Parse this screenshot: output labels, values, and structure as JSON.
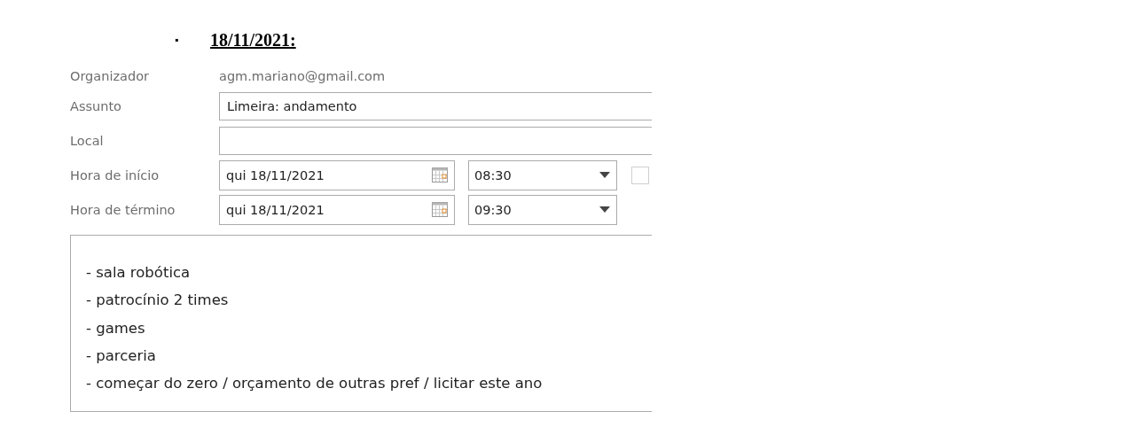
{
  "heading": {
    "bullet": "▪",
    "date": "18/11/2021:"
  },
  "organizer": {
    "label": "Organizador",
    "value": "agm.mariano@gmail.com"
  },
  "subject": {
    "label": "Assunto",
    "value": "Limeira: andamento"
  },
  "location": {
    "label": "Local"
  },
  "start": {
    "label": "Hora de início",
    "date": "qui 18/11/2021",
    "time": "08:30",
    "all_day_checked": false
  },
  "end": {
    "label": "Hora de término",
    "date": "qui 18/11/2021",
    "time": "09:30"
  },
  "body_lines": [
    "- sala robótica",
    "- patrocínio 2 times",
    "- games",
    "- parceria",
    "- começar do zero / orçamento de outras pref / licitar este ano"
  ]
}
